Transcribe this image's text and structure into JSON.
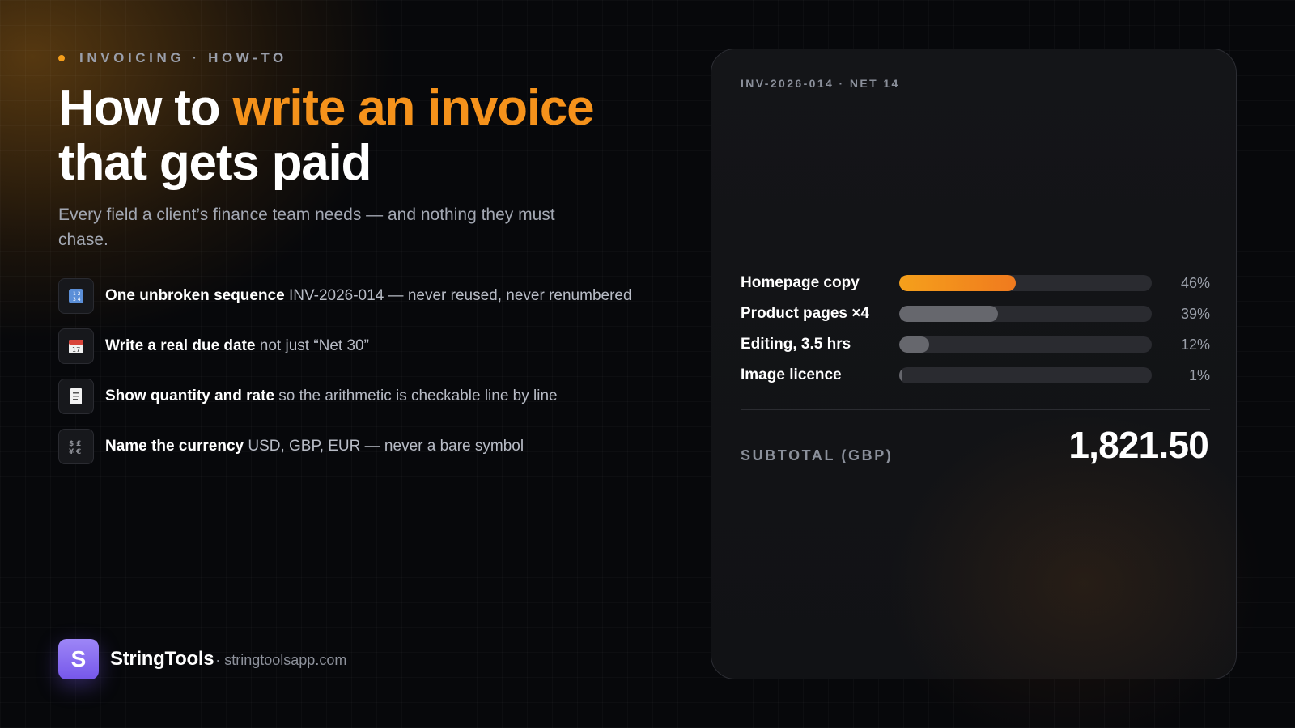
{
  "eyebrow": "INVOICING · HOW-TO",
  "title": {
    "line1_plain": "How to ",
    "line1_accent": "write an invoice",
    "line2": "that gets paid"
  },
  "subtitle": "Every field a client’s finance team needs — and nothing they must chase.",
  "items": [
    {
      "icon": "numbers-icon",
      "bold": "One unbroken sequence",
      "rest": " INV-2026-014 — never reused, never renumbered"
    },
    {
      "icon": "calendar-icon",
      "bold": "Write a real due date",
      "rest": " not just “Net 30”"
    },
    {
      "icon": "receipt-icon",
      "bold": "Show quantity and rate",
      "rest": " so the arithmetic is checkable line by line"
    },
    {
      "icon": "currency-exchange-icon",
      "bold": "Name the currency",
      "rest": " USD, GBP, EUR — never a bare symbol"
    }
  ],
  "brand": {
    "logo_letter": "S",
    "name": "StringTools",
    "url": "· stringtoolsapp.com"
  },
  "card": {
    "eyebrow": "INV-2026-014 · NET 14",
    "lines": [
      {
        "label": "Homepage copy",
        "share": 0.46,
        "pct": "46%",
        "highlight": true
      },
      {
        "label": "Product pages ×4",
        "share": 0.39,
        "pct": "39%",
        "highlight": false
      },
      {
        "label": "Editing, 3.5 hrs",
        "share": 0.12,
        "pct": "12%",
        "highlight": false
      },
      {
        "label": "Image licence",
        "share": 0.01,
        "pct": "1%",
        "highlight": false
      }
    ],
    "subtotal_label": "SUBTOTAL (GBP)",
    "subtotal_value": "1,821.50"
  },
  "colors": {
    "accent": "#f5921b",
    "background": "#07080b",
    "card": "#131417",
    "brand": "#8a6ef2",
    "muted_bar": "#66676d"
  }
}
